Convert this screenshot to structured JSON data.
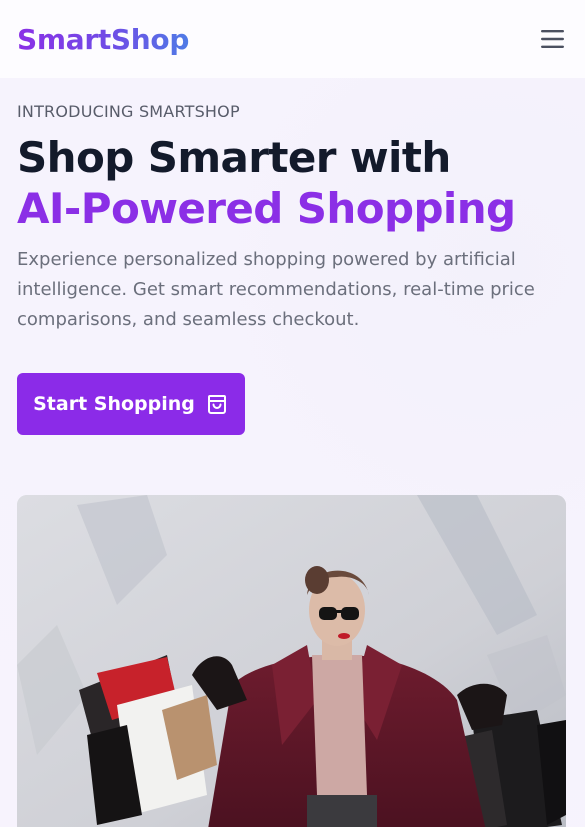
{
  "header": {
    "brand": "SmartShop",
    "menu_icon": "hamburger-menu-icon"
  },
  "hero": {
    "eyebrow": "INTRODUCING SMARTSHOP",
    "headline_line1": "Shop Smarter with",
    "headline_line2": "AI-Powered Shopping",
    "description": "Experience personalized shopping powered by artificial intelligence. Get smart recommendations, real-time price comparisons, and seamless checkout.",
    "cta_label": "Start Shopping",
    "cta_icon": "shopping-bag-icon"
  },
  "image": {
    "subject": "woman-holding-shopping-bags"
  },
  "colors": {
    "brand_purple": "#8b2be8",
    "brand_gradient_end": "#4f7be6",
    "headline_dark": "#131a2b",
    "body_text": "#6b6f7c",
    "background": "#f6f3fd"
  }
}
